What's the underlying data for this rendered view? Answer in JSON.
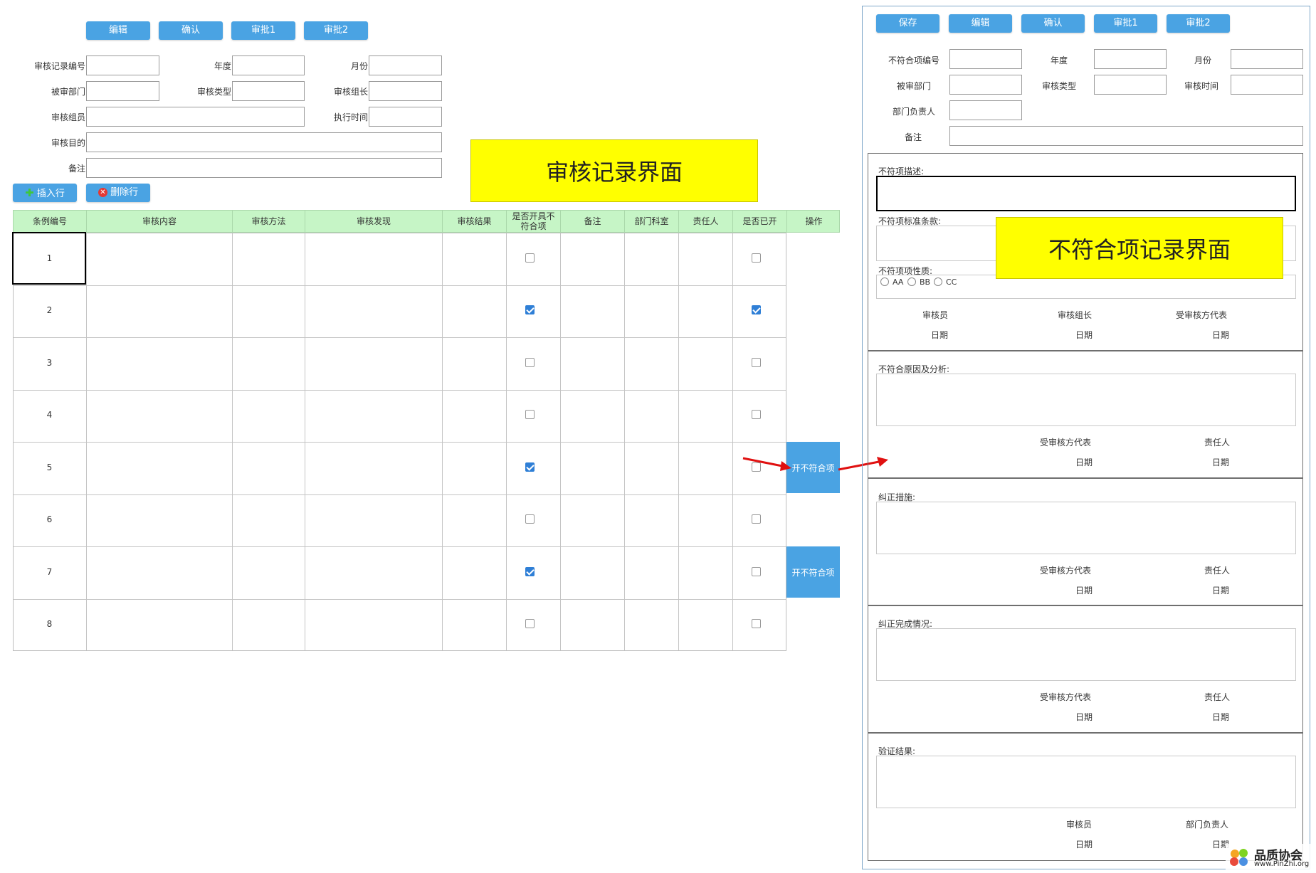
{
  "left_form": {
    "buttons": [
      "编辑",
      "确认",
      "审批1",
      "审批2"
    ],
    "fields": {
      "record_no": "审核记录编号",
      "year": "年度",
      "month": "月份",
      "audited_dept": "被审部门",
      "audit_type": "审核类型",
      "audit_leader": "审核组长",
      "audit_members": "审核组员",
      "exec_time": "执行时间",
      "audit_purpose": "审核目的",
      "remarks": "备注"
    },
    "insert_row": "插入行",
    "delete_row": "删除行"
  },
  "sticky_left": "审核记录界面",
  "sticky_right": "不符合项记录界面",
  "table": {
    "headers": [
      "条例编号",
      "审核内容",
      "审核方法",
      "审核发现",
      "审核结果",
      "是否开具不符合项",
      "备注",
      "部门科室",
      "责任人",
      "是否已开",
      "操作"
    ],
    "rows": [
      {
        "no": "1",
        "nc": false,
        "opened": false,
        "action": ""
      },
      {
        "no": "2",
        "nc": true,
        "opened": true,
        "action": ""
      },
      {
        "no": "3",
        "nc": false,
        "opened": false,
        "action": ""
      },
      {
        "no": "4",
        "nc": false,
        "opened": false,
        "action": ""
      },
      {
        "no": "5",
        "nc": true,
        "opened": false,
        "action": "开不符合项"
      },
      {
        "no": "6",
        "nc": false,
        "opened": false,
        "action": ""
      },
      {
        "no": "7",
        "nc": true,
        "opened": false,
        "action": "开不符合项"
      },
      {
        "no": "8",
        "nc": false,
        "opened": false,
        "action": ""
      }
    ]
  },
  "right_form": {
    "buttons": [
      "保存",
      "编辑",
      "确认",
      "审批1",
      "审批2"
    ],
    "fields": {
      "nc_no": "不符合项编号",
      "year": "年度",
      "month": "月份",
      "audited_dept": "被审部门",
      "audit_type": "审核类型",
      "audit_time": "审核时间",
      "dept_head": "部门负责人",
      "remarks": "备注"
    },
    "nc_desc": "不符项描述:",
    "nc_clause": "不符项标准条款:",
    "nc_nature": "不符项项性质:",
    "nature_options": [
      "AA",
      "BB",
      "CC"
    ],
    "auditor": "审核员",
    "leader": "审核组长",
    "auditee_rep": "受审核方代表",
    "date": "日期",
    "cause_analysis": "不符合原因及分析:",
    "responsible": "责任人",
    "corrective": "纠正措施:",
    "completion": "纠正完成情况:",
    "verification": "验证结果:",
    "dept_head_sig": "部门负责人"
  },
  "watermark": {
    "name": "品质协会",
    "url": "www.PinZhi.org"
  },
  "colors": {
    "button_blue": "#4aa3e3",
    "header_green": "#c6f5c6",
    "sticky_yellow": "#ffff00",
    "arrow_red": "#e01010",
    "check_blue": "#2f7fd6"
  }
}
